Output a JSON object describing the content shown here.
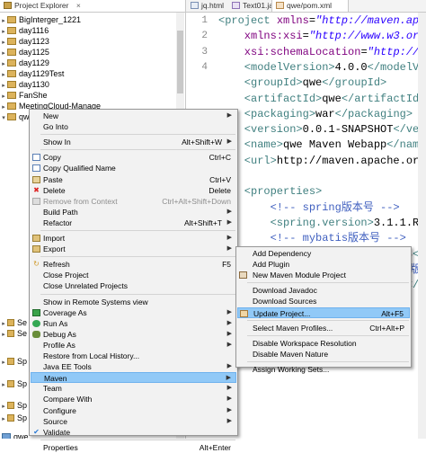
{
  "tabs": [
    {
      "label": "Project Explorer",
      "close": "×"
    },
    {
      "label": "jq.html"
    },
    {
      "label": "Text01.java"
    },
    {
      "label": "qwe/pom.xml",
      "close": "×"
    }
  ],
  "explorer": {
    "items": [
      {
        "label": "BigInterger_1221",
        "expanded": false
      },
      {
        "label": "day1116",
        "expanded": false
      },
      {
        "label": "day1123",
        "expanded": false
      },
      {
        "label": "day1125",
        "expanded": false
      },
      {
        "label": "day1129",
        "expanded": false
      },
      {
        "label": "day1129Test",
        "expanded": false
      },
      {
        "label": "day1130",
        "expanded": false
      },
      {
        "label": "FanShe",
        "expanded": false
      },
      {
        "label": "MeetingCloud-Manage",
        "expanded": false
      },
      {
        "label": "qwe",
        "expanded": true
      }
    ],
    "partial_rows": [
      "Se",
      "Se",
      "Sp",
      "Sp",
      "Sp",
      "Sp"
    ],
    "bottom_item": "qwe"
  },
  "editor": {
    "line_numbers": [
      "1",
      "2",
      "3",
      "4"
    ],
    "lines": [
      [
        {
          "t": "tag",
          "v": "<project "
        },
        {
          "t": "attr",
          "v": "xmlns"
        },
        {
          "t": "txt",
          "v": "="
        },
        {
          "t": "str",
          "v": "\"http://maven.apac"
        }
      ],
      [
        {
          "t": "attr",
          "v": "    xmlns:xsi"
        },
        {
          "t": "txt",
          "v": "="
        },
        {
          "t": "str",
          "v": "\"http://www.w3.org/"
        }
      ],
      [
        {
          "t": "attr",
          "v": "    xsi:schemaLocation"
        },
        {
          "t": "txt",
          "v": "="
        },
        {
          "t": "str",
          "v": "\"http://ma"
        }
      ],
      [
        {
          "t": "tag",
          "v": "    <modelVersion>"
        },
        {
          "t": "txt",
          "v": "4.0.0"
        },
        {
          "t": "tag",
          "v": "</modelVer"
        }
      ],
      [
        {
          "t": "tag",
          "v": "    <groupId>"
        },
        {
          "t": "txt",
          "v": "qwe"
        },
        {
          "t": "tag",
          "v": "</groupId>"
        }
      ],
      [
        {
          "t": "tag",
          "v": "    <artifactId>"
        },
        {
          "t": "txt",
          "v": "qwe"
        },
        {
          "t": "tag",
          "v": "</artifactId>"
        }
      ],
      [
        {
          "t": "tag",
          "v": "    <packaging>"
        },
        {
          "t": "txt",
          "v": "war"
        },
        {
          "t": "tag",
          "v": "</packaging>"
        }
      ],
      [
        {
          "t": "tag",
          "v": "    <version>"
        },
        {
          "t": "txt",
          "v": "0.0.1-SNAPSHOT"
        },
        {
          "t": "tag",
          "v": "</vers"
        }
      ],
      [
        {
          "t": "tag",
          "v": "    <name>"
        },
        {
          "t": "txt",
          "v": "qwe Maven Webapp"
        },
        {
          "t": "tag",
          "v": "</name>"
        }
      ],
      [
        {
          "t": "tag",
          "v": "    <url>"
        },
        {
          "t": "txt",
          "v": "http://maven.apache.org"
        },
        {
          "t": "tag",
          "v": "<"
        }
      ],
      [
        {
          "t": "txt",
          "v": ""
        }
      ],
      [
        {
          "t": "tag",
          "v": "    <properties>"
        }
      ],
      [
        {
          "t": "cmt",
          "v": "        <!-- spring版本号 -->"
        }
      ],
      [
        {
          "t": "tag",
          "v": "        <spring.version>"
        },
        {
          "t": "txt",
          "v": "3.1.1.REL"
        }
      ],
      [
        {
          "t": "cmt",
          "v": "        <!-- mybatis版本号 -->"
        }
      ],
      [
        {
          "t": "tag",
          "v": "        <mybatis.version>"
        },
        {
          "t": "txt",
          "v": "3.2.8"
        },
        {
          "t": "tag",
          "v": "</"
        }
      ],
      [
        {
          "t": "cmt",
          "v": "        <!-- log4j日志文件管理包版本"
        }
      ],
      [
        {
          "t": "tag",
          "v": "        <slf4j.version>"
        },
        {
          "t": "txt",
          "v": "1.7.12"
        },
        {
          "t": "tag",
          "v": "</sl"
        }
      ],
      [
        {
          "t": "tag",
          "v": "                                    lo"
        }
      ]
    ]
  },
  "context_menu": {
    "items": [
      {
        "label": "New",
        "submenu": true
      },
      {
        "label": "Go Into"
      },
      {
        "sep": true
      },
      {
        "label": "Show In",
        "shortcut": "Alt+Shift+W",
        "submenu": true
      },
      {
        "sep": true
      },
      {
        "label": "Copy",
        "shortcut": "Ctrl+C",
        "icon": "copy-icon"
      },
      {
        "label": "Copy Qualified Name",
        "icon": "copy-qualified-icon"
      },
      {
        "label": "Paste",
        "shortcut": "Ctrl+V",
        "icon": "paste-icon"
      },
      {
        "label": "Delete",
        "shortcut": "Delete",
        "icon": "delete-icon"
      },
      {
        "label": "Remove from Context",
        "shortcut": "Ctrl+Alt+Shift+Down",
        "disabled": true,
        "icon": "remove-context-icon"
      },
      {
        "label": "Build Path",
        "submenu": true
      },
      {
        "label": "Refactor",
        "shortcut": "Alt+Shift+T",
        "submenu": true
      },
      {
        "sep": true
      },
      {
        "label": "Import",
        "submenu": true,
        "icon": "import-icon"
      },
      {
        "label": "Export",
        "submenu": true,
        "icon": "export-icon"
      },
      {
        "sep": true
      },
      {
        "label": "Refresh",
        "shortcut": "F5",
        "icon": "refresh-icon"
      },
      {
        "label": "Close Project"
      },
      {
        "label": "Close Unrelated Projects"
      },
      {
        "sep": true
      },
      {
        "label": "Show in Remote Systems view"
      },
      {
        "label": "Coverage As",
        "submenu": true,
        "icon": "coverage-icon"
      },
      {
        "label": "Run As",
        "submenu": true,
        "icon": "run-icon"
      },
      {
        "label": "Debug As",
        "submenu": true,
        "icon": "debug-icon"
      },
      {
        "label": "Profile As",
        "submenu": true
      },
      {
        "label": "Restore from Local History..."
      },
      {
        "label": "Java EE Tools",
        "submenu": true
      },
      {
        "label": "Maven",
        "submenu": true,
        "highlighted": true
      },
      {
        "label": "Team",
        "submenu": true
      },
      {
        "label": "Compare With",
        "submenu": true
      },
      {
        "label": "Configure",
        "submenu": true
      },
      {
        "label": "Source",
        "submenu": true
      },
      {
        "label": "Validate",
        "icon": "validate-icon"
      },
      {
        "sep": true
      },
      {
        "label": "Properties",
        "shortcut": "Alt+Enter"
      }
    ]
  },
  "maven_submenu": {
    "items": [
      {
        "label": "Add Dependency"
      },
      {
        "label": "Add Plugin"
      },
      {
        "label": "New Maven Module Project",
        "icon": "maven-module-icon"
      },
      {
        "sep": true
      },
      {
        "label": "Download Javadoc"
      },
      {
        "label": "Download Sources"
      },
      {
        "label": "Update Project...",
        "shortcut": "Alt+F5",
        "highlighted": true,
        "icon": "update-project-icon"
      },
      {
        "sep": true
      },
      {
        "label": "Select Maven Profiles...",
        "shortcut": "Ctrl+Alt+P"
      },
      {
        "sep": true
      },
      {
        "label": "Disable Workspace Resolution"
      },
      {
        "label": "Disable Maven Nature"
      },
      {
        "sep": true
      },
      {
        "label": "Assign Working Sets..."
      }
    ]
  },
  "colors": {
    "highlight": "#91c9f7",
    "menu_bg": "#f2f2f2",
    "xml_tag": "#3f7f7f",
    "xml_attr": "#7f007f",
    "xml_string": "#2a00ff",
    "xml_comment": "#3f5fbf"
  }
}
